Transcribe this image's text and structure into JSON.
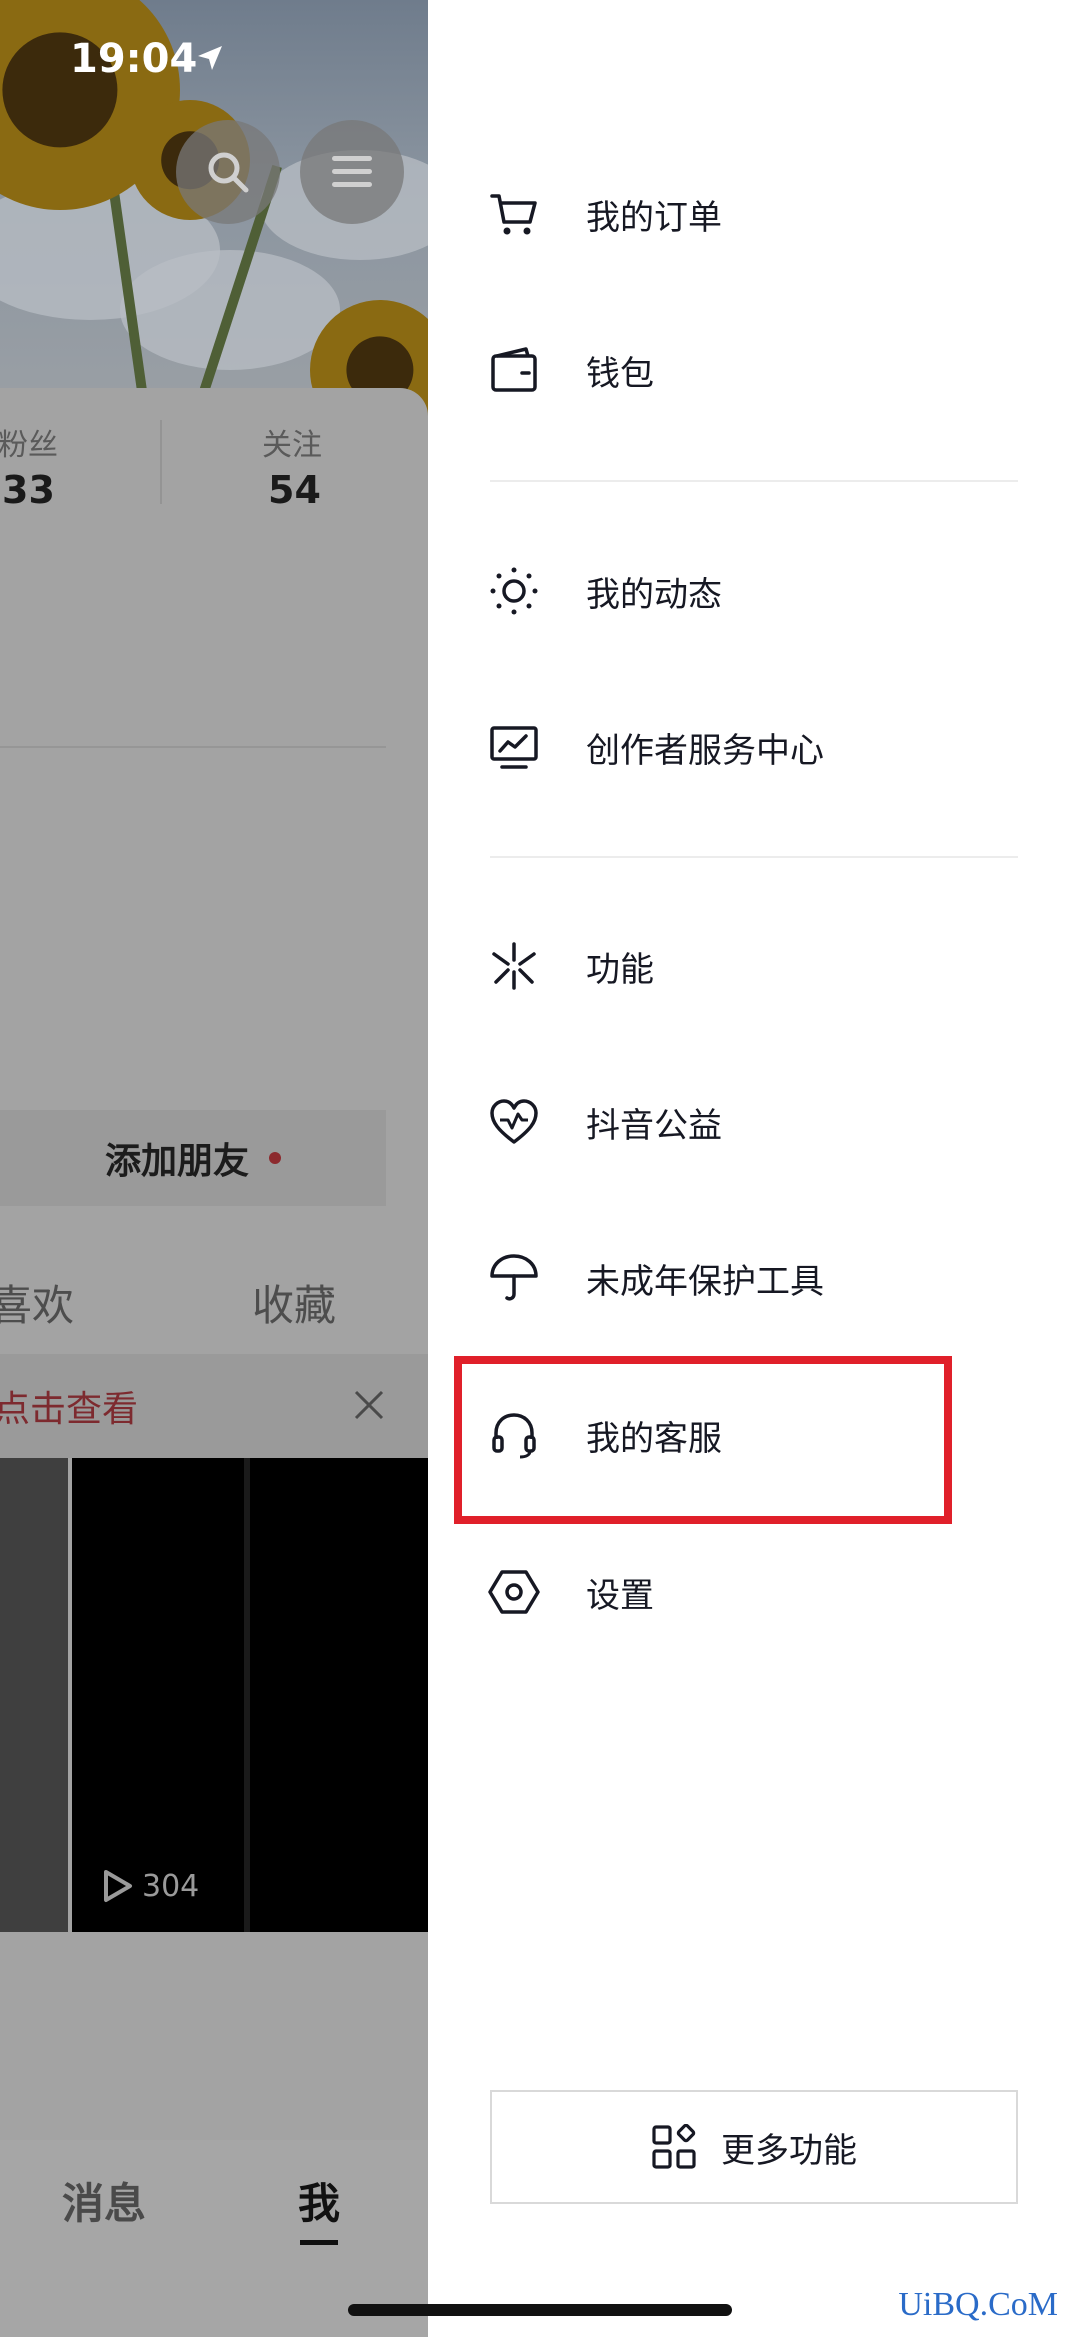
{
  "status_bar": {
    "time": "19:04"
  },
  "profile": {
    "stats": [
      {
        "label": "粉丝",
        "value": "33"
      },
      {
        "label": "关注",
        "value": "54"
      }
    ],
    "add_friend_label": "添加朋友",
    "tabs": [
      "喜欢",
      "收藏"
    ],
    "notice_text": "点击查看",
    "video_play_count": "304"
  },
  "bottom_nav": {
    "items": [
      {
        "label": "消息"
      },
      {
        "label": "我",
        "active": true
      }
    ]
  },
  "drawer": {
    "items": [
      {
        "label": "我的订单",
        "icon": "cart-icon"
      },
      {
        "label": "钱包",
        "icon": "wallet-icon"
      },
      {
        "label": "我的动态",
        "icon": "activity-sun-icon"
      },
      {
        "label": "创作者服务中心",
        "icon": "creator-monitor-icon"
      },
      {
        "label": "功能",
        "icon": "sparkle-icon"
      },
      {
        "label": "抖音公益",
        "icon": "charity-heart-icon"
      },
      {
        "label": "未成年保护工具",
        "icon": "umbrella-icon"
      },
      {
        "label": "我的客服",
        "icon": "headset-icon",
        "highlighted": true
      },
      {
        "label": "设置",
        "icon": "settings-hexagon-icon"
      }
    ],
    "more_features_label": "更多功能",
    "highlight_color": "#e0202a"
  },
  "watermark": "UiBQ.CoM"
}
